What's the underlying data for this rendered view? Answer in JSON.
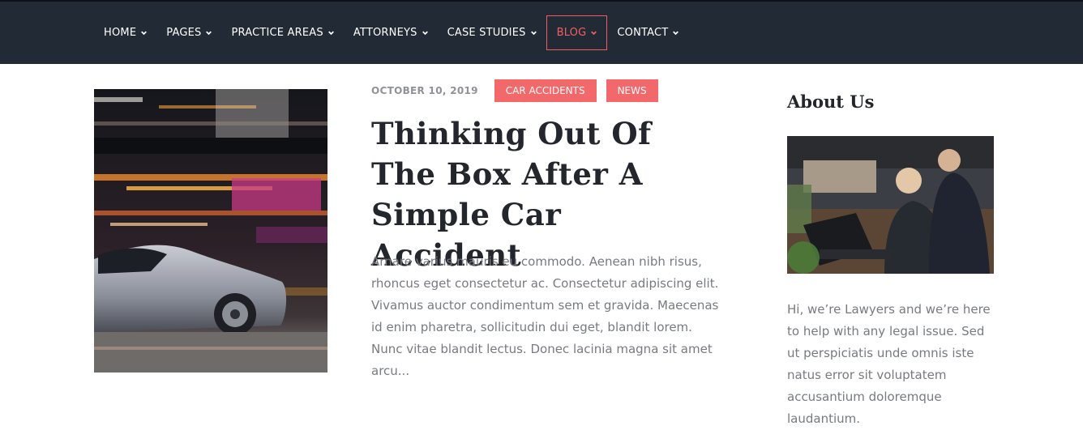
{
  "nav": {
    "items": [
      {
        "label": "HOME"
      },
      {
        "label": "PAGES"
      },
      {
        "label": "PRACTICE AREAS"
      },
      {
        "label": "ATTORNEYS"
      },
      {
        "label": "CASE STUDIES"
      },
      {
        "label": "BLOG",
        "active": true
      },
      {
        "label": "CONTACT"
      }
    ]
  },
  "post": {
    "date": "OCTOBER 10, 2019",
    "tags": [
      "CAR ACCIDENTS",
      "NEWS"
    ],
    "title": "Thinking Out Of The Box After A Simple Car Accident",
    "excerpt": "Arnare varius mauris eu commodo. Aenean nibh risus, rhoncus eget consectetur ac. Consectetur adipiscing elit. Vivamus auctor condimentum sem et gravida. Maecenas id enim pharetra, sollicitudin dui eget, blandit lorem. Nunc vitae blandit lectus. Donec lacinia magna sit amet arcu..."
  },
  "sidebar": {
    "title": "About Us",
    "text": "Hi, we’re Lawyers and we’re here to help with any legal issue. Sed ut perspiciatis unde omnis iste natus error sit voluptatem accusantium doloremque laudantium."
  },
  "colors": {
    "nav_bg": "#222a36",
    "accent": "#f2686b",
    "heading": "#23262c",
    "body_text": "#777b80"
  }
}
